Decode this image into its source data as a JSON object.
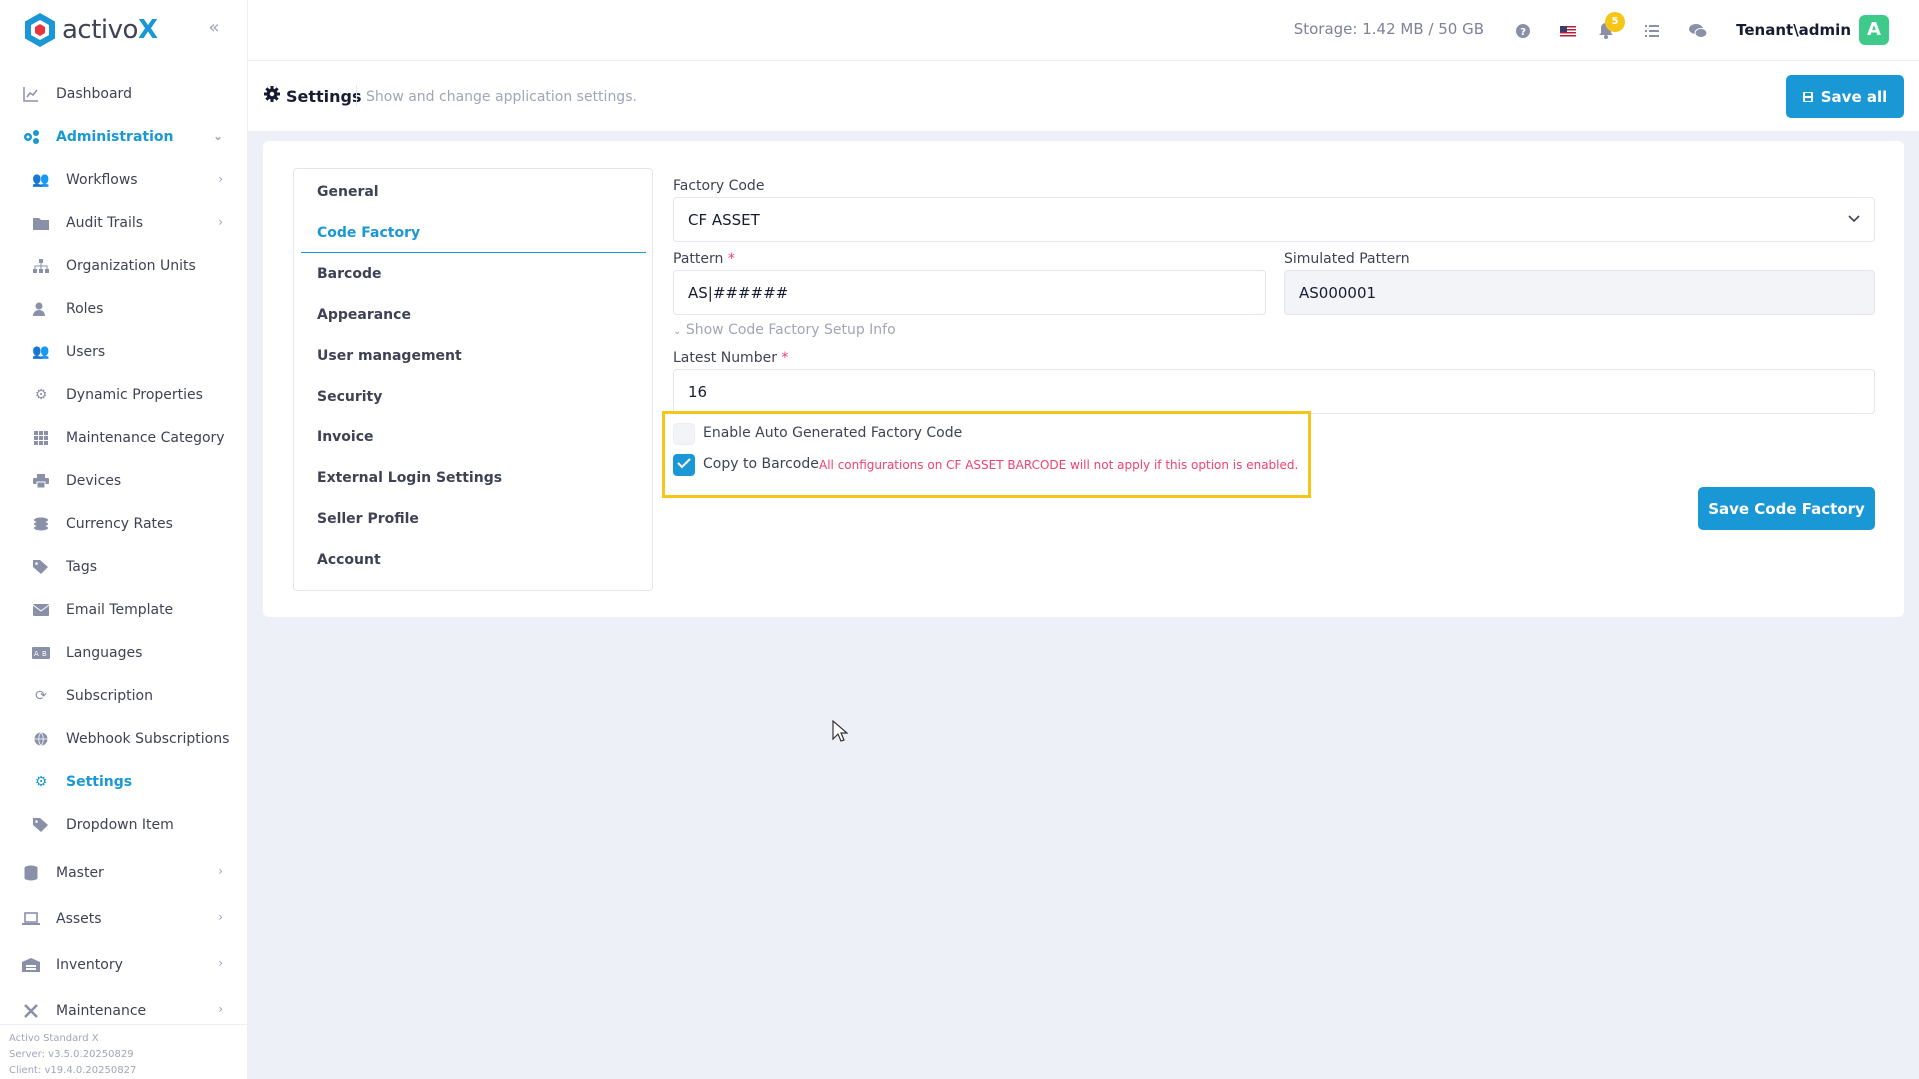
{
  "app": {
    "logo_text": "activo",
    "logo_x": "X",
    "brand_color": "#1a98d5",
    "version": [
      "Activo Standard X",
      "Server: v3.5.0.20250829",
      "Client: v19.4.0.20250827"
    ]
  },
  "sidebar": {
    "items": [
      {
        "label": "Dashboard",
        "icon": "chart-line-icon"
      },
      {
        "label": "Administration",
        "icon": "cogs-icon"
      },
      {
        "label": "Master",
        "icon": "database-icon"
      },
      {
        "label": "Assets",
        "icon": "laptop-icon"
      },
      {
        "label": "Inventory",
        "icon": "warehouse-icon"
      },
      {
        "label": "Maintenance",
        "icon": "tools-icon"
      }
    ],
    "admin_sub": [
      {
        "label": "Workflows",
        "icon": "users-icon"
      },
      {
        "label": "Audit Trails",
        "icon": "folder-icon"
      },
      {
        "label": "Organization Units",
        "icon": "sitemap-icon"
      },
      {
        "label": "Roles",
        "icon": "user-tag-icon"
      },
      {
        "label": "Users",
        "icon": "users-icon"
      },
      {
        "label": "Dynamic Properties",
        "icon": "gear-icon"
      },
      {
        "label": "Maintenance Category",
        "icon": "grid-icon"
      },
      {
        "label": "Devices",
        "icon": "printer-icon"
      },
      {
        "label": "Currency Rates",
        "icon": "coins-icon"
      },
      {
        "label": "Tags",
        "icon": "tags-icon"
      },
      {
        "label": "Email Template",
        "icon": "envelope-icon"
      },
      {
        "label": "Languages",
        "icon": "language-icon"
      },
      {
        "label": "Subscription",
        "icon": "sync-icon"
      },
      {
        "label": "Webhook Subscriptions",
        "icon": "globe-icon"
      },
      {
        "label": "Settings",
        "icon": "gear-icon"
      },
      {
        "label": "Dropdown Item",
        "icon": "tags-icon"
      }
    ]
  },
  "topbar": {
    "storage": "Storage: 1.42 MB / 50 GB",
    "notification_count": "5",
    "user": "Tenant\\admin",
    "avatar_letter": "A"
  },
  "subheader": {
    "title": "Settings",
    "description": "Show and change application settings.",
    "save_all": "Save all"
  },
  "tabs": [
    "General",
    "Code Factory",
    "Barcode",
    "Appearance",
    "User management",
    "Security",
    "Invoice",
    "External Login Settings",
    "Seller Profile",
    "Account"
  ],
  "form": {
    "factory_code_label": "Factory Code",
    "factory_code_value": "CF ASSET",
    "pattern_label": "Pattern",
    "pattern_value": "AS|######",
    "simulated_label": "Simulated Pattern",
    "simulated_value": "AS000001",
    "setup_info": "Show Code Factory Setup Info",
    "latest_number_label": "Latest Number",
    "latest_number_value": "16",
    "required_mark": "*",
    "auto_gen_label": "Enable Auto Generated Factory Code",
    "auto_gen_checked": false,
    "copy_barcode_label": "Copy to Barcode",
    "copy_barcode_checked": true,
    "copy_barcode_warning": "All configurations on CF ASSET BARCODE will not apply if this option is enabled.",
    "save_button": "Save Code Factory"
  }
}
